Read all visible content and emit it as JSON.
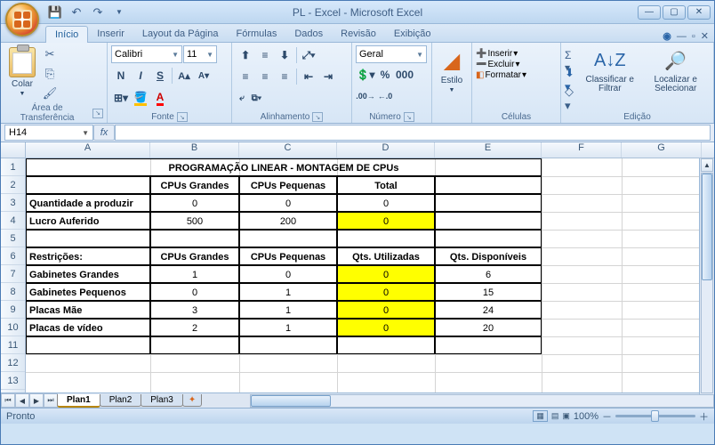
{
  "title": "PL - Excel - Microsoft Excel",
  "tabs": {
    "inicio": "Início",
    "inserir": "Inserir",
    "layout": "Layout da Página",
    "formulas": "Fórmulas",
    "dados": "Dados",
    "revisao": "Revisão",
    "exibicao": "Exibição"
  },
  "ribbon": {
    "clipboard": {
      "label": "Área de Transferência",
      "paste": "Colar"
    },
    "font": {
      "label": "Fonte",
      "name": "Calibri",
      "size": "11"
    },
    "align": {
      "label": "Alinhamento"
    },
    "number": {
      "label": "Número",
      "format": "Geral"
    },
    "style": {
      "label": "Estilo"
    },
    "cells": {
      "label": "Células",
      "insert": "Inserir",
      "delete": "Excluir",
      "format": "Formatar"
    },
    "edit": {
      "label": "Edição",
      "sort": "Classificar e Filtrar",
      "find": "Localizar e Selecionar"
    }
  },
  "namebox": "H14",
  "cols": [
    "A",
    "B",
    "C",
    "D",
    "E",
    "F",
    "G"
  ],
  "rows": [
    "1",
    "2",
    "3",
    "4",
    "5",
    "6",
    "7",
    "8",
    "9",
    "10",
    "11",
    "12",
    "13"
  ],
  "sheet": {
    "title": "PROGRAMAÇÃO LINEAR - MONTAGEM DE CPUs",
    "h_b": "CPUs Grandes",
    "h_c": "CPUs Pequenas",
    "h_d": "Total",
    "r3a": "Quantidade a produzir",
    "r3b": "0",
    "r3c": "0",
    "r3d": "0",
    "r4a": "Lucro Auferido",
    "r4b": "500",
    "r4c": "200",
    "r4d": "0",
    "r6a": "Restrições:",
    "r6b": "CPUs Grandes",
    "r6c": "CPUs Pequenas",
    "r6d": "Qts. Utilizadas",
    "r6e": "Qts. Disponíveis",
    "r7a": "Gabinetes Grandes",
    "r7b": "1",
    "r7c": "0",
    "r7d": "0",
    "r7e": "6",
    "r8a": "Gabinetes Pequenos",
    "r8b": "0",
    "r8c": "1",
    "r8d": "0",
    "r8e": "15",
    "r9a": "Placas Mãe",
    "r9b": "3",
    "r9c": "1",
    "r9d": "0",
    "r9e": "24",
    "r10a": "Placas de vídeo",
    "r10b": "2",
    "r10c": "1",
    "r10d": "0",
    "r10e": "20"
  },
  "tabs_sheet": {
    "p1": "Plan1",
    "p2": "Plan2",
    "p3": "Plan3"
  },
  "status": "Pronto",
  "zoom": "100%"
}
